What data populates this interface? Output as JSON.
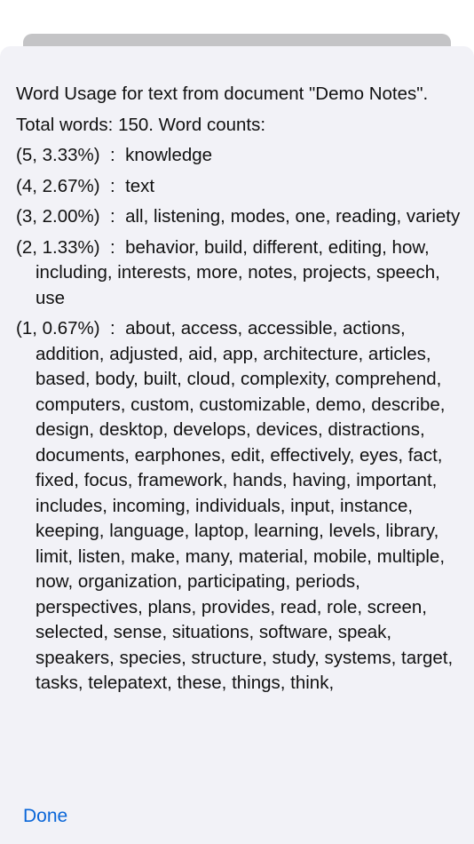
{
  "header": {
    "line": "Word Usage for text from document \"Demo Notes\"."
  },
  "summary": "Total words: 150. Word counts:",
  "groups": [
    {
      "count": "(5, 3.33%)",
      "sep": "  :  ",
      "words": "knowledge"
    },
    {
      "count": "(4, 2.67%)",
      "sep": "  :  ",
      "words": "text"
    },
    {
      "count": "(3, 2.00%)",
      "sep": "  :  ",
      "words": "all, listening, modes, one, reading, variety"
    },
    {
      "count": "(2, 1.33%)",
      "sep": "  :  ",
      "words": "behavior, build, different, editing, how, including, interests, more, notes, projects, speech, use"
    },
    {
      "count": "(1, 0.67%)",
      "sep": "  :  ",
      "words": "about, access, accessible, actions, addition, adjusted, aid, app, architecture, articles, based, body, built, cloud, complexity, comprehend, computers, custom, customizable, demo, describe, design, desktop, develops, devices, distractions, documents, earphones, edit, effectively, eyes, fact, fixed, focus, framework, hands, having, important, includes, incoming, individuals, input, instance, keeping, language, laptop, learning, levels, library, limit, listen, make, many, material, mobile, multiple, now, organization, participating, periods, perspectives, plans, provides, read, role, screen, selected, sense, situations, software, speak, speakers, species, structure, study, systems, target, tasks, telepatext, these, things, think,"
    }
  ],
  "footer": {
    "done_label": "Done"
  }
}
